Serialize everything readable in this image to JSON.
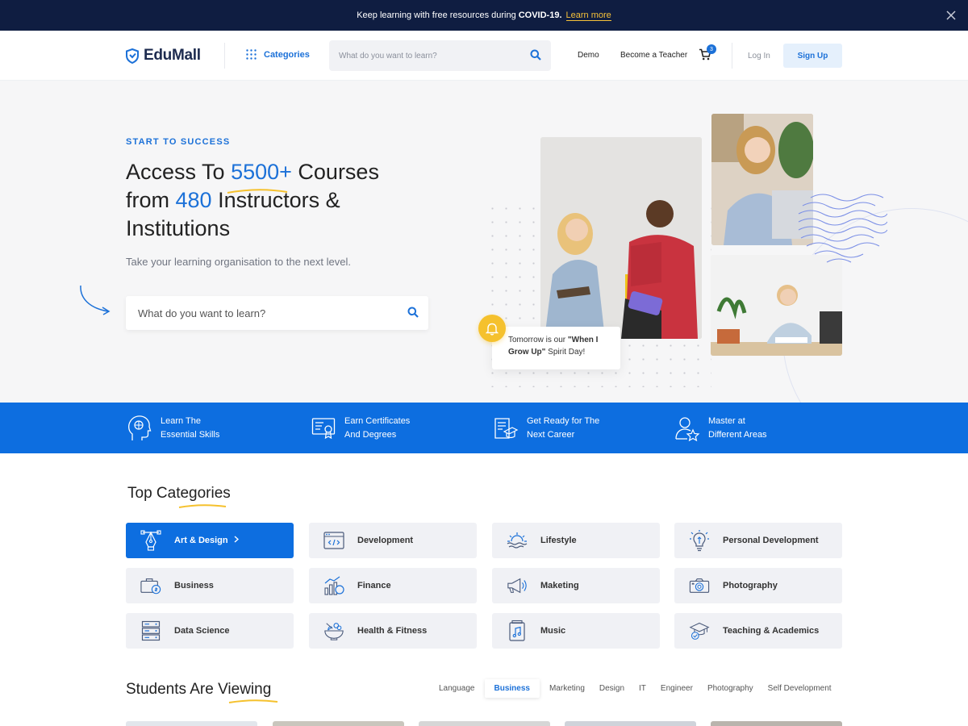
{
  "announcement": {
    "text": "Keep learning with free resources during",
    "bold": "COVID-19.",
    "link": "Learn more"
  },
  "header": {
    "logo": "EduMall",
    "categories_label": "Categories",
    "search_placeholder": "What do you want to learn?",
    "nav": [
      "Demo",
      "Become a Teacher"
    ],
    "cart_count": "3",
    "login": "Log In",
    "signup": "Sign Up"
  },
  "hero": {
    "eyebrow": "START TO SUCCESS",
    "title_1": "Access To ",
    "title_num1": "5500+",
    "title_2": " Courses",
    "title_3": "from ",
    "title_num2": "480",
    "title_4": " Instructors &",
    "title_5": "Institutions",
    "subtitle": "Take your learning organisation to the next level.",
    "search_placeholder": "What do you want to learn?",
    "note_pre": "Tomorrow is our ",
    "note_bold": "\"When I Grow Up\"",
    "note_post": " Spirit Day!"
  },
  "features": [
    {
      "line1": "Learn The",
      "line2": "Essential Skills",
      "icon": "brain-head-icon"
    },
    {
      "line1": "Earn Certificates",
      "line2": "And Degrees",
      "icon": "certificate-icon"
    },
    {
      "line1": "Get Ready for The",
      "line2": "Next Career",
      "icon": "career-document-icon"
    },
    {
      "line1": "Master at",
      "line2": "Different Areas",
      "icon": "user-star-icon"
    }
  ],
  "categories": {
    "title": "Top Categories",
    "items": [
      {
        "label": "Art & Design",
        "icon": "pen-tool-icon",
        "active": true
      },
      {
        "label": "Development",
        "icon": "code-window-icon"
      },
      {
        "label": "Lifestyle",
        "icon": "sunrise-icon"
      },
      {
        "label": "Personal Development",
        "icon": "lightbulb-icon"
      },
      {
        "label": "Business",
        "icon": "briefcase-icon"
      },
      {
        "label": "Finance",
        "icon": "finance-chart-icon"
      },
      {
        "label": "Maketing",
        "icon": "megaphone-icon"
      },
      {
        "label": "Photography",
        "icon": "camera-icon"
      },
      {
        "label": "Data Science",
        "icon": "server-icon"
      },
      {
        "label": "Health & Fitness",
        "icon": "healthy-bowl-icon"
      },
      {
        "label": "Music",
        "icon": "music-file-icon"
      },
      {
        "label": "Teaching & Academics",
        "icon": "graduation-cap-icon"
      }
    ]
  },
  "viewing": {
    "title": "Students Are Viewing",
    "tabs": [
      "Language",
      "Business",
      "Marketing",
      "Design",
      "IT",
      "Engineer",
      "Photography",
      "Self Development"
    ],
    "active_tab": "Business"
  },
  "colors": {
    "brand_blue": "#0d6ee0",
    "navy": "#0f1d41",
    "accent_yellow": "#f5c12d"
  }
}
